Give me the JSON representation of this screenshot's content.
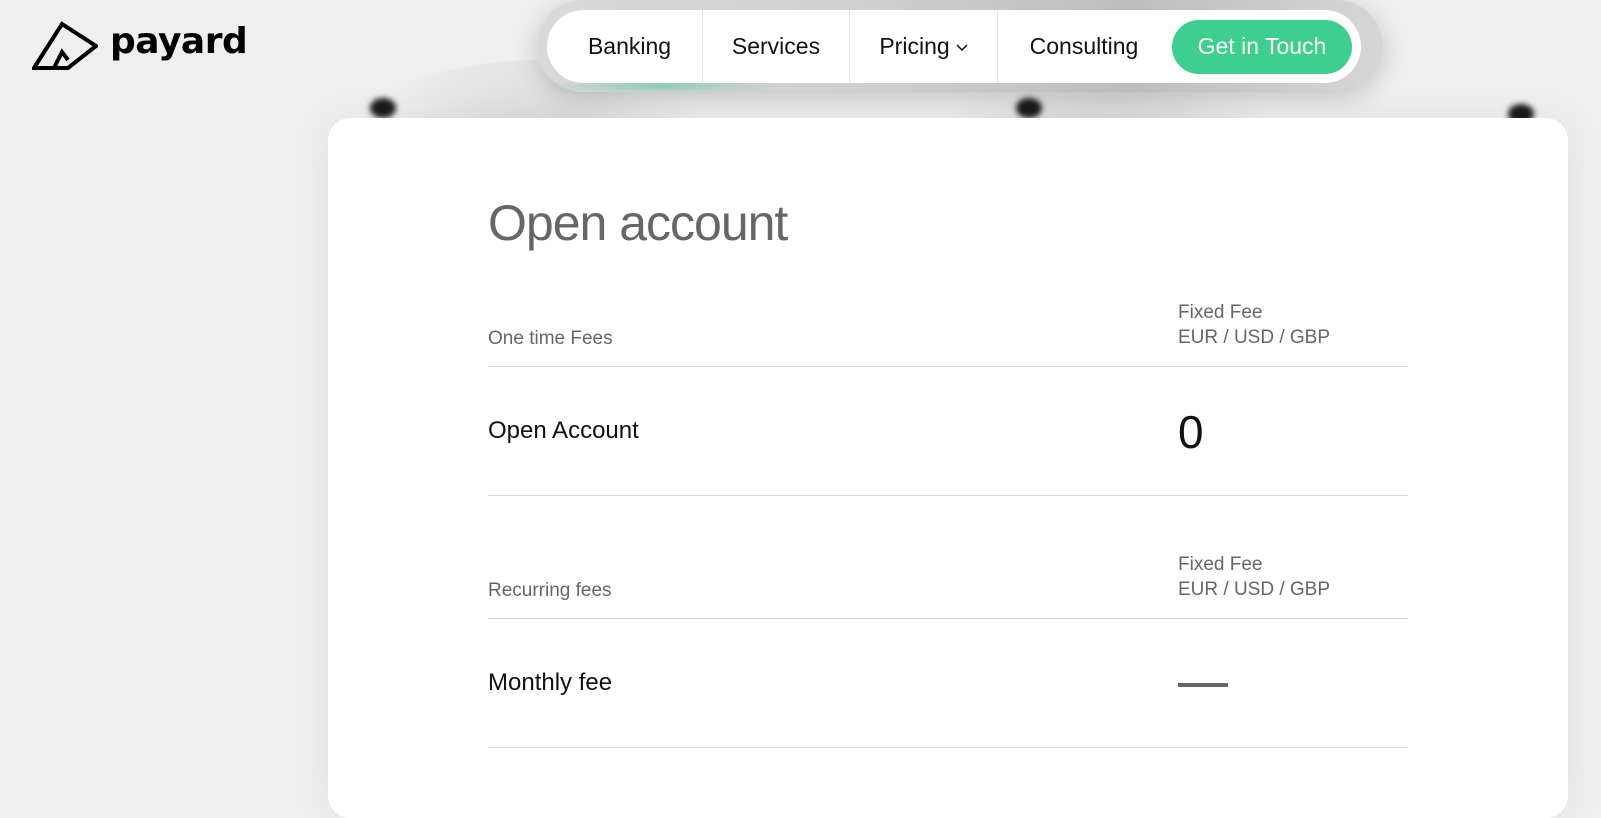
{
  "brand": {
    "name": "payard"
  },
  "nav": {
    "items": [
      {
        "label": "Banking"
      },
      {
        "label": "Services"
      },
      {
        "label": "Pricing"
      },
      {
        "label": "Consulting"
      }
    ],
    "cta_label": "Get in Touch"
  },
  "colors": {
    "accent": "#3ecf8e",
    "background": "#efefef",
    "title_gray": "#666666"
  },
  "page": {
    "title": "Open account"
  },
  "sections": [
    {
      "label": "One time Fees",
      "fee_header_line1": "Fixed Fee",
      "fee_header_line2": "EUR / USD / GBP",
      "rows": [
        {
          "label": "Open Account",
          "value": "0"
        }
      ]
    },
    {
      "label": "Recurring fees",
      "fee_header_line1": "Fixed Fee",
      "fee_header_line2": "EUR / USD / GBP",
      "rows": [
        {
          "label": "Monthly fee",
          "value": "—"
        }
      ]
    }
  ]
}
